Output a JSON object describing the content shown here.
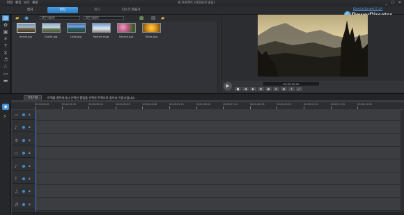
{
  "menubar": {
    "items": [
      "파일",
      "편집",
      "보기",
      "재생"
    ],
    "title": "새 프로젝트 (저장되지 않음)",
    "window_controls": "_ □ ✕"
  },
  "modebar": {
    "tabs": [
      {
        "label": "캡처"
      },
      {
        "label": "편집",
        "active": true
      },
      {
        "label": "제작"
      },
      {
        "label": "디스크 만들기"
      }
    ],
    "account_link": "DirectorZone에 로그인",
    "brand": "PowerDirector"
  },
  "library": {
    "filter": "모든 미디어",
    "sort": "모든 미디어",
    "items": [
      {
        "name": "Aerial.jpg",
        "icon": "image-thumbnail"
      },
      {
        "name": "Castle.jpg",
        "icon": "image-thumbnail"
      },
      {
        "name": "Lake.jpg",
        "icon": "image-thumbnail"
      },
      {
        "name": "Nature.mpg",
        "icon": "video-thumbnail"
      },
      {
        "name": "Sakura.jpg",
        "icon": "image-thumbnail"
      },
      {
        "name": "Tulips.jpg",
        "icon": "image-thumbnail"
      }
    ]
  },
  "preview": {
    "timecode": "00;00;00;00",
    "controls": [
      "■",
      "◀",
      "▶",
      "◆",
      "▣",
      "⇄",
      "◉",
      "⇕",
      "⤢"
    ]
  },
  "info_bar": {
    "button": "이전/다음",
    "hint": "트랙을 클릭하거나 선택한 클립을 선택한 트랙으로 끌어서 이동시킵니다."
  },
  "timeline": {
    "ticks": [
      "00;00;00;00",
      "00;00;01;02",
      "00;00;02;04",
      "00;00;03;06",
      "00;00;04;08",
      "00;00;05;10",
      "00;00;06;12",
      "00;00;07;14",
      "00;00;08;16",
      "00;00;09;18",
      "00;00;10;20",
      "00;00;11;22",
      "00;00;12;24"
    ],
    "tracks": [
      {
        "icon": "video-track-icon",
        "glyph": "▭"
      },
      {
        "icon": "audio-track-icon",
        "glyph": "♪"
      },
      {
        "icon": "fx-track-icon",
        "glyph": "✲"
      },
      {
        "icon": "video-track-icon",
        "glyph": "▭"
      },
      {
        "icon": "audio-track-icon",
        "glyph": "♪"
      },
      {
        "icon": "title-track-icon",
        "glyph": "T"
      },
      {
        "icon": "voice-track-icon",
        "glyph": "♫"
      },
      {
        "icon": "music-track-icon",
        "glyph": "♬"
      }
    ]
  },
  "colors": {
    "accent": "#3f8fd6",
    "panel": "#313338",
    "background": "#1e1f22"
  }
}
